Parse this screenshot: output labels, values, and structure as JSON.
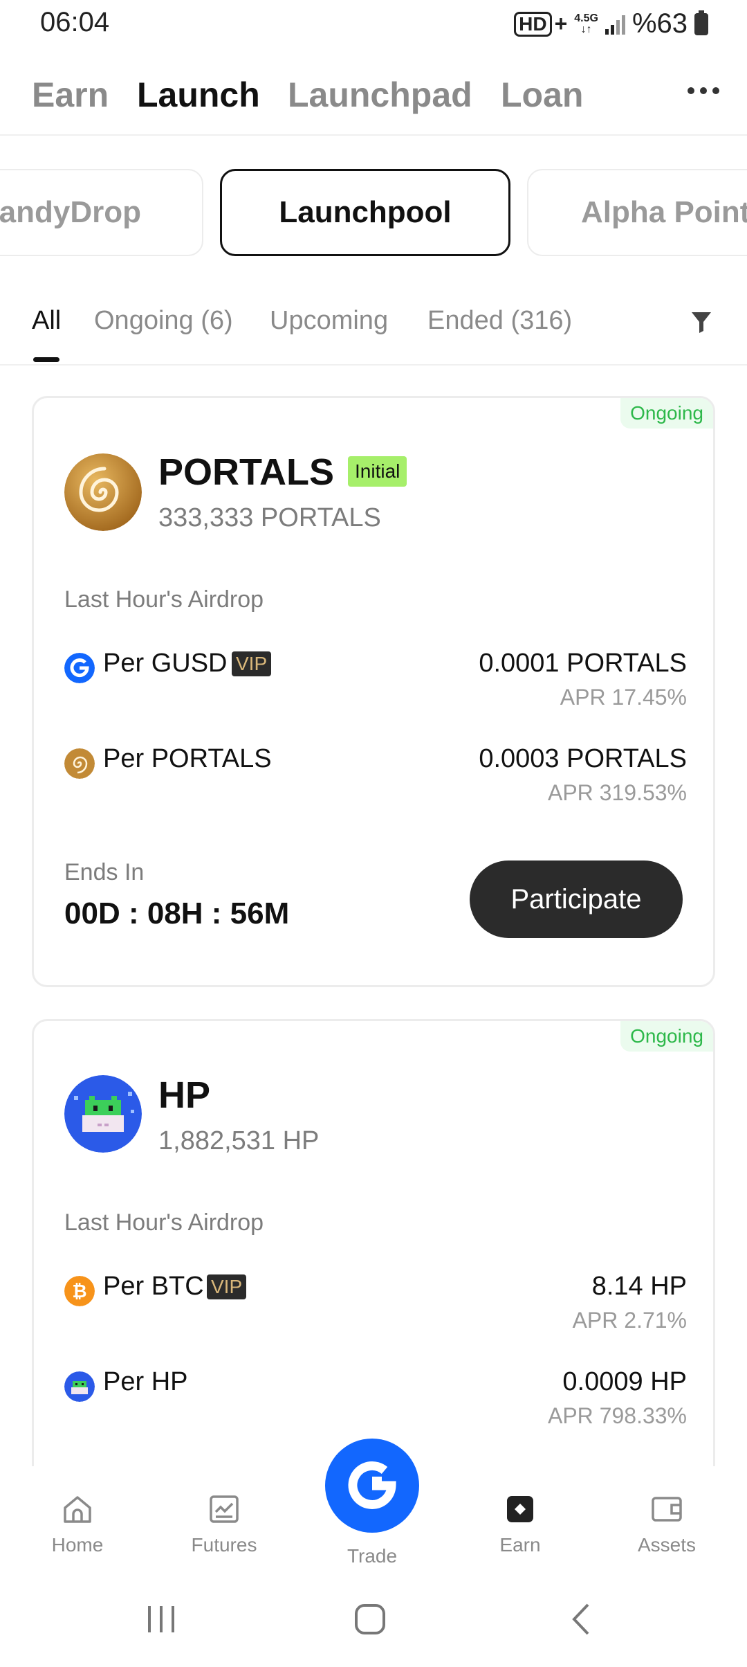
{
  "status_bar": {
    "time": "06:04",
    "hd": "HD",
    "plus": "+",
    "net_top": "4.5G",
    "net_bottom": "↓↑",
    "battery": "%63"
  },
  "top_nav": {
    "tabs": [
      {
        "label": "Earn",
        "active": false
      },
      {
        "label": "Launch",
        "active": true
      },
      {
        "label": "Launchpad",
        "active": false
      },
      {
        "label": "Loan",
        "active": false
      }
    ]
  },
  "sub_tabs": {
    "items": [
      {
        "label": "CandyDrop",
        "active": false
      },
      {
        "label": "Launchpool",
        "active": true
      },
      {
        "label": "Alpha Points",
        "active": false
      }
    ]
  },
  "filters": {
    "items": [
      {
        "label": "All",
        "active": true
      },
      {
        "label": "Ongoing (6)",
        "active": false
      },
      {
        "label": "Upcoming",
        "active": false
      },
      {
        "label": "Ended (316)",
        "active": false
      }
    ]
  },
  "cards": [
    {
      "status": "Ongoing",
      "name": "PORTALS",
      "tag": "Initial",
      "amount": "333,333 PORTALS",
      "airdrop_label": "Last Hour's Airdrop",
      "pools": [
        {
          "label": "Per GUSD",
          "vip": "VIP",
          "value": "0.0001 PORTALS",
          "apr": "APR 17.45%"
        },
        {
          "label": "Per PORTALS",
          "vip": "",
          "value": "0.0003 PORTALS",
          "apr": "APR 319.53%"
        }
      ],
      "ends_label": "Ends In",
      "ends_value": "00D : 08H : 56M",
      "button": "Participate"
    },
    {
      "status": "Ongoing",
      "name": "HP",
      "tag": "",
      "amount": "1,882,531 HP",
      "airdrop_label": "Last Hour's Airdrop",
      "pools": [
        {
          "label": "Per BTC",
          "vip": "VIP",
          "value": "8.14 HP",
          "apr": "APR 2.71%"
        },
        {
          "label": "Per HP",
          "vip": "",
          "value": "0.0009 HP",
          "apr": "APR 798.33%"
        }
      ]
    }
  ],
  "bottom_nav": {
    "items": [
      {
        "label": "Home",
        "icon": "home-icon"
      },
      {
        "label": "Futures",
        "icon": "futures-icon"
      },
      {
        "label": "Trade",
        "icon": "trade-icon"
      },
      {
        "label": "Earn",
        "icon": "earn-icon"
      },
      {
        "label": "Assets",
        "icon": "assets-icon"
      }
    ]
  },
  "colors": {
    "accent_blue": "#1267fe",
    "ongoing_green": "#2db84a",
    "initial_tag": "#a6ef6a",
    "vip_gold": "#d9b77a"
  }
}
